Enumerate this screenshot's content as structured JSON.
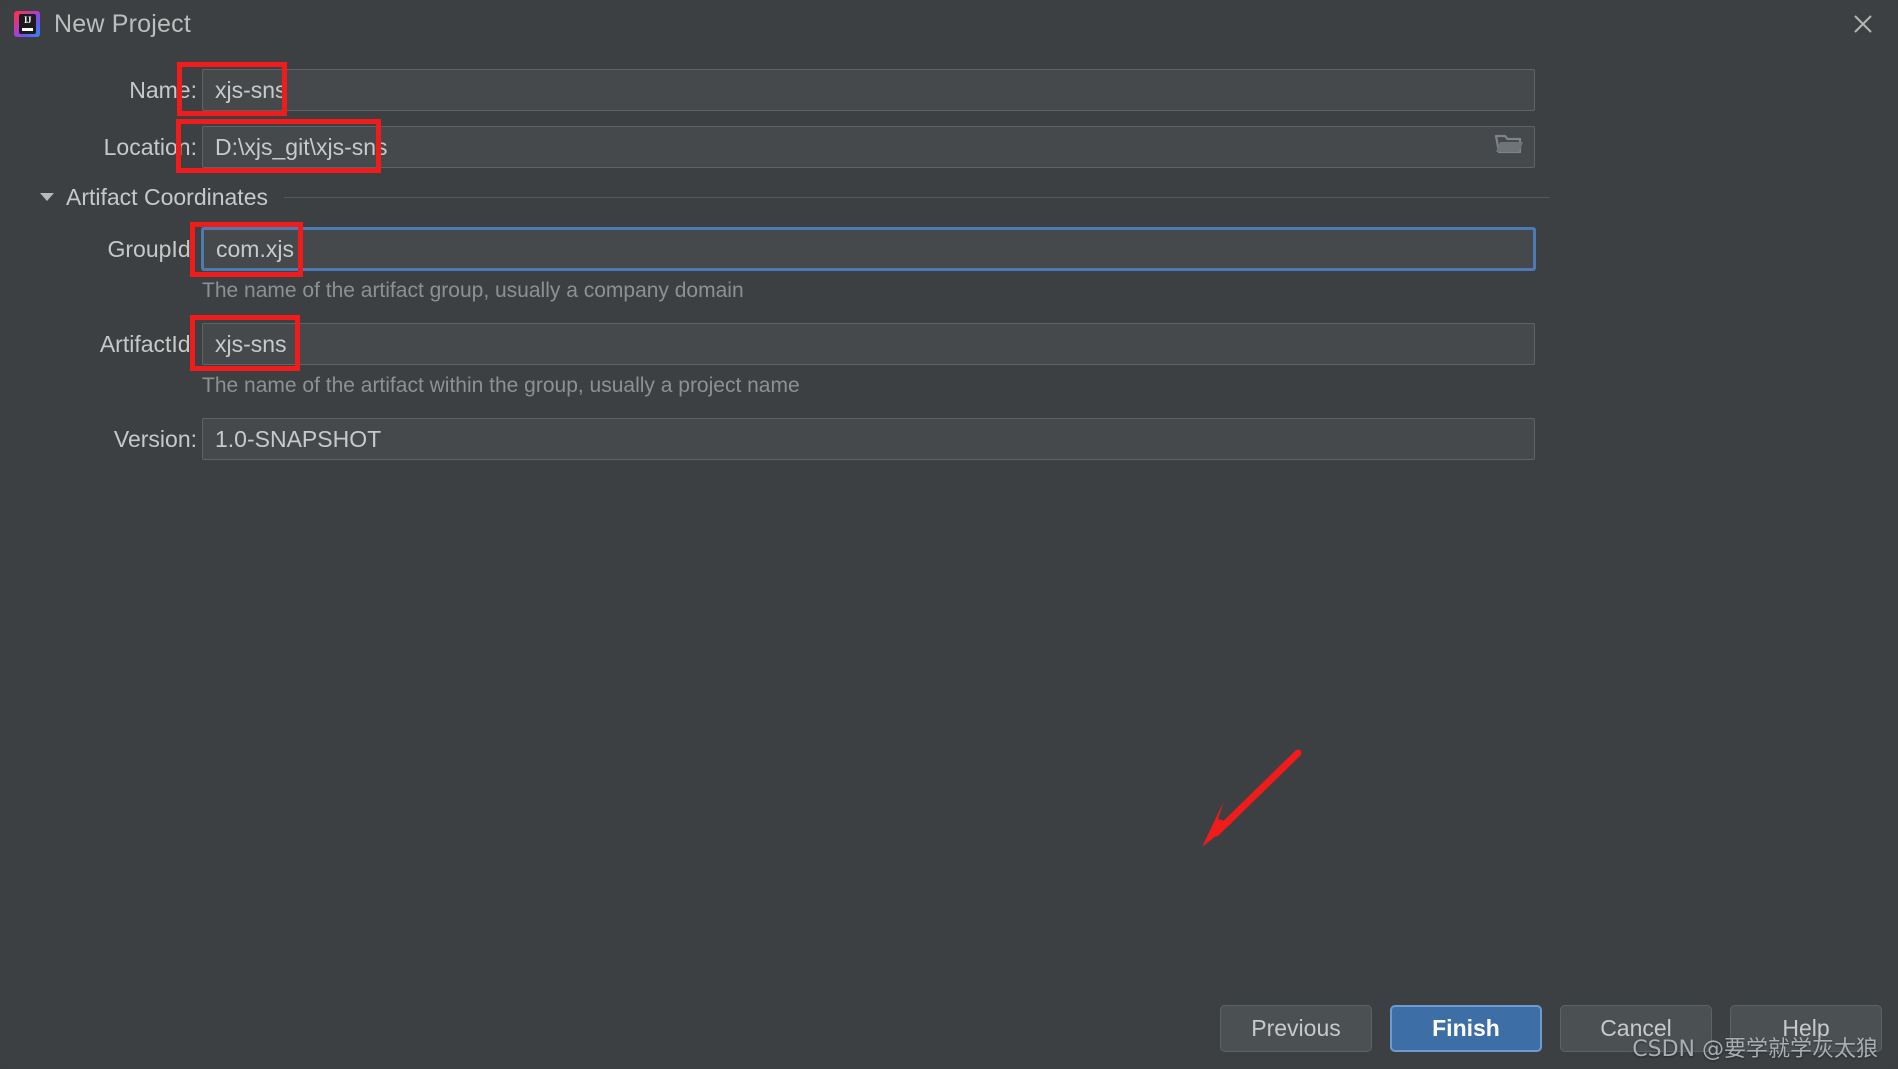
{
  "window": {
    "title": "New Project",
    "logo_icon": "intellij-idea-logo",
    "close_icon": "close-icon"
  },
  "form": {
    "name": {
      "label": "Name:",
      "value": "xjs-sns"
    },
    "location": {
      "label": "Location:",
      "value": "D:\\xjs_git\\xjs-sns",
      "browse_icon": "folder-icon"
    },
    "artifact_coordinates": {
      "section_label": "Artifact Coordinates",
      "expanded": true,
      "toggle_icon": "chevron-down-icon",
      "group_id": {
        "label": "GroupId:",
        "value": "com.xjs",
        "hint": "The name of the artifact group, usually a company domain",
        "focused": true
      },
      "artifact_id": {
        "label": "ArtifactId:",
        "value": "xjs-sns",
        "hint": "The name of the artifact within the group, usually a project name"
      },
      "version": {
        "label": "Version:",
        "value": "1.0-SNAPSHOT"
      }
    }
  },
  "buttons": {
    "previous": "Previous",
    "finish": "Finish",
    "cancel": "Cancel",
    "help": "Help"
  },
  "annotations": {
    "highlight_color": "#f01b1b",
    "arrow_target": "finish-button"
  },
  "watermark": "CSDN @要学就学灰太狼",
  "colors": {
    "dialog_background": "#3c4043",
    "field_background": "#45494c",
    "field_border": "#5e6366",
    "focus_border": "#4e7ab3",
    "primary_button": "#3d6ea5",
    "text": "#c8c8c8",
    "hint_text": "#8d9194"
  }
}
